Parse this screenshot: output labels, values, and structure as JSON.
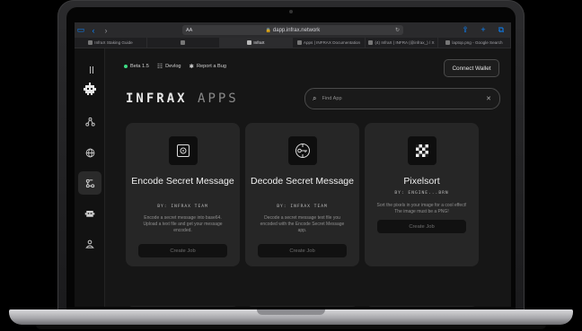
{
  "browser": {
    "url": "dapp.infrax.network",
    "reader_label": "AA",
    "tabs": [
      {
        "label": "InfraX Staking Guide",
        "active": false
      },
      {
        "label": "",
        "active": false
      },
      {
        "label": "InfraX",
        "active": true
      },
      {
        "label": "Apps | INFRAX Documentation",
        "active": false
      },
      {
        "label": "(4) InfraX | INFRA (@infrax_) / X",
        "active": false
      },
      {
        "label": "laptop.png - Google Search",
        "active": false
      }
    ]
  },
  "topnav": {
    "beta_label": "Beta 1.5",
    "devlog_label": "Devlog",
    "bug_label": "Report a Bug",
    "connect_label": "Connect Wallet"
  },
  "logo": {
    "main": "INFRAX",
    "sub": "APPS"
  },
  "search": {
    "placeholder": "Find App"
  },
  "cards": [
    {
      "title": "Encode Secret Message",
      "by": "BY: INFRAX TEAM",
      "desc": "Encode a secret message into base64. Upload a text file and get your message encoded.",
      "button": "Create Job"
    },
    {
      "title": "Decode Secret Message",
      "by": "BY: INFRAX TEAM",
      "desc": "Decode a secret message text file you encoded with the Encode Secret Message app.",
      "button": "Create Job"
    },
    {
      "title": "Pixelsort",
      "by": "BY: ENGINE...BRN",
      "desc": "Sort the pixels in your image for a cool effect! The image must be a PNG!",
      "button": "Create Job"
    }
  ],
  "colors": {
    "accent_green": "#3ddc84",
    "safari_blue": "#0a84ff"
  }
}
